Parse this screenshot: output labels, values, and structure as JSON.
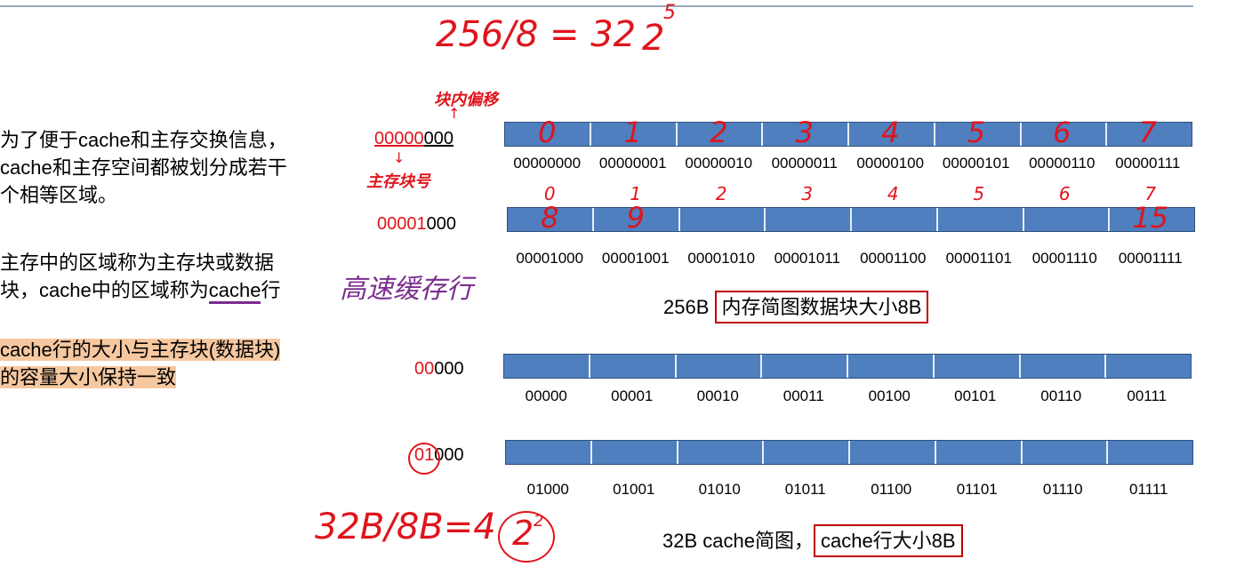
{
  "left_text": {
    "p1_line1": "为了便于cache和主存交换信息，",
    "p1_line2": "cache和主存空间都被划分成若干",
    "p1_line3": "个相等区域。",
    "p2_line1": "主存中的区域称为主存块或数据",
    "p2_line2_a": "块，cache中的区域称为",
    "p2_line2_b": "cache",
    "p2_line2_c": "行",
    "p3_line1": "cache行的大小与主存块(数据块)",
    "p3_line2": "的容量大小保持一致"
  },
  "addresses": {
    "mem_row1_red": "00000",
    "mem_row1_black": "000",
    "mem_row2_red": "00001",
    "mem_row2_black": "000",
    "cache_row1_red": "00",
    "cache_row1_black": "000",
    "cache_row2_red": "01",
    "cache_row2_black": "000"
  },
  "memory_labels_row1": [
    "00000000",
    "00000001",
    "00000010",
    "00000011",
    "00000100",
    "00000101",
    "00000110",
    "00000111"
  ],
  "memory_labels_row2": [
    "00001000",
    "00001001",
    "00001010",
    "00001011",
    "00001100",
    "00001101",
    "00001110",
    "00001111"
  ],
  "cache_labels_row1": [
    "00000",
    "00001",
    "00010",
    "00011",
    "00100",
    "00101",
    "00110",
    "00111"
  ],
  "cache_labels_row2": [
    "01000",
    "01001",
    "01010",
    "01011",
    "01100",
    "01101",
    "01110",
    "01111"
  ],
  "captions": {
    "memory_prefix": "256B ",
    "memory_boxed": "内存简图数据块大小8B",
    "cache_prefix": "32B cache简图，",
    "cache_boxed": "cache行大小8B"
  },
  "handwriting": {
    "top_formula": "256/8 = 32",
    "top_power_base": "2",
    "top_power_exp": "5",
    "block_offset": "块内偏移",
    "block_number": "主存块号",
    "cache_line_note": "高速缓存行",
    "bottom_formula": "32B/8B=4",
    "bottom_power_base": "2",
    "bottom_power_exp": "2",
    "row1_numbers": [
      "0",
      "1",
      "2",
      "3",
      "4",
      "5",
      "6",
      "7"
    ],
    "row2_top_numbers": [
      "0",
      "1",
      "2",
      "3",
      "4",
      "5",
      "6",
      "7"
    ],
    "row2_low_numbers": [
      "8",
      "9",
      "",
      "",
      "",
      "",
      "",
      "15"
    ]
  }
}
